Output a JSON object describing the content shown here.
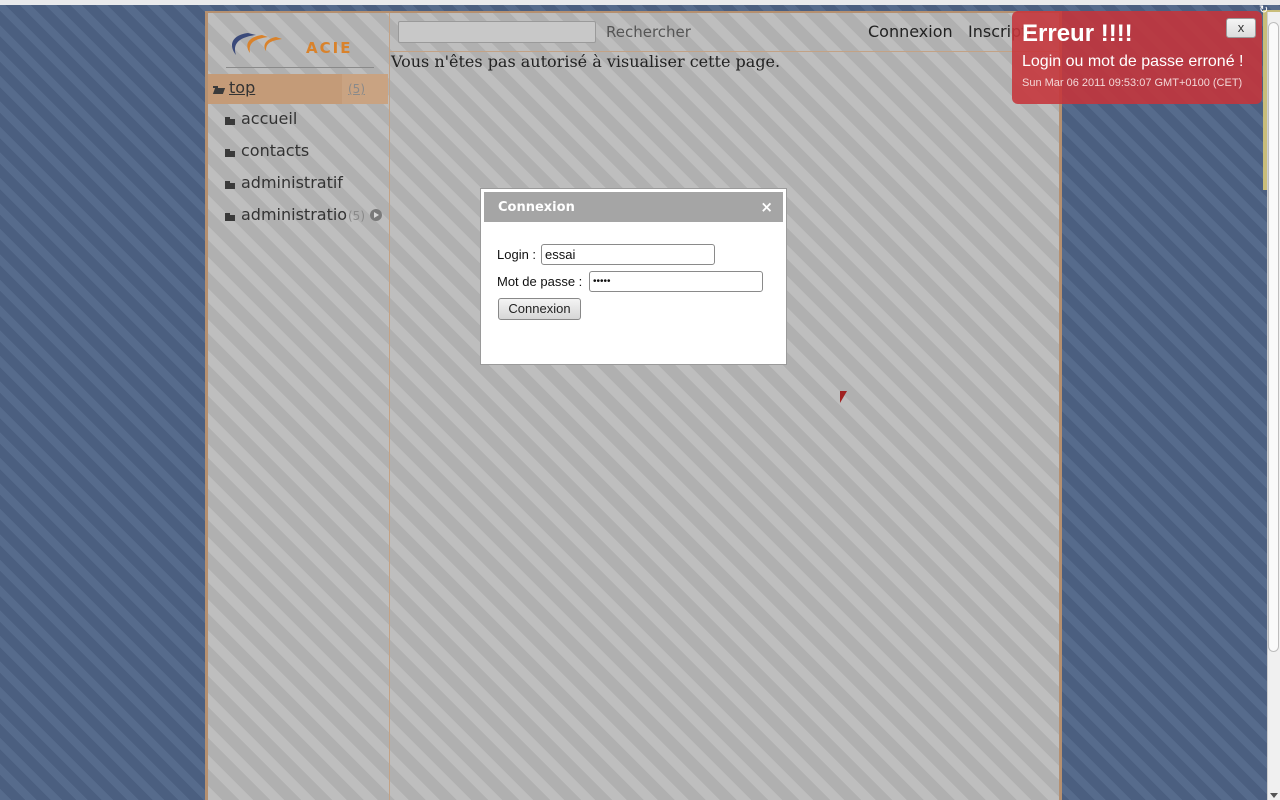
{
  "sidebar": {
    "logo_text": "ACIE",
    "top_item": {
      "label": "top",
      "count": "(5)"
    },
    "items": [
      {
        "label": "accueil"
      },
      {
        "label": "contacts"
      },
      {
        "label": "administratif"
      },
      {
        "label": "administratio",
        "count": "(5)"
      }
    ]
  },
  "header": {
    "search_placeholder": "",
    "search_button": "Rechercher",
    "connexion_link": "Connexion",
    "inscription_link": "Inscripti"
  },
  "main": {
    "message": "Vous n'êtes pas autorisé à visualiser cette page."
  },
  "dialog": {
    "title": "Connexion",
    "close": "×",
    "login_label": "Login :",
    "login_value": "essai",
    "password_label": "Mot de passe :",
    "password_value": "•••••",
    "submit_label": "Connexion"
  },
  "toast": {
    "title": "Erreur !!!!",
    "message": "Login ou mot de passe erroné !",
    "timestamp": "Sun Mar 06 2011 09:53:07 GMT+0100 (CET)",
    "close": "x"
  },
  "colors": {
    "toast_bg": "#c6343a",
    "accent": "#c49b78",
    "logo": "#d9822b"
  }
}
